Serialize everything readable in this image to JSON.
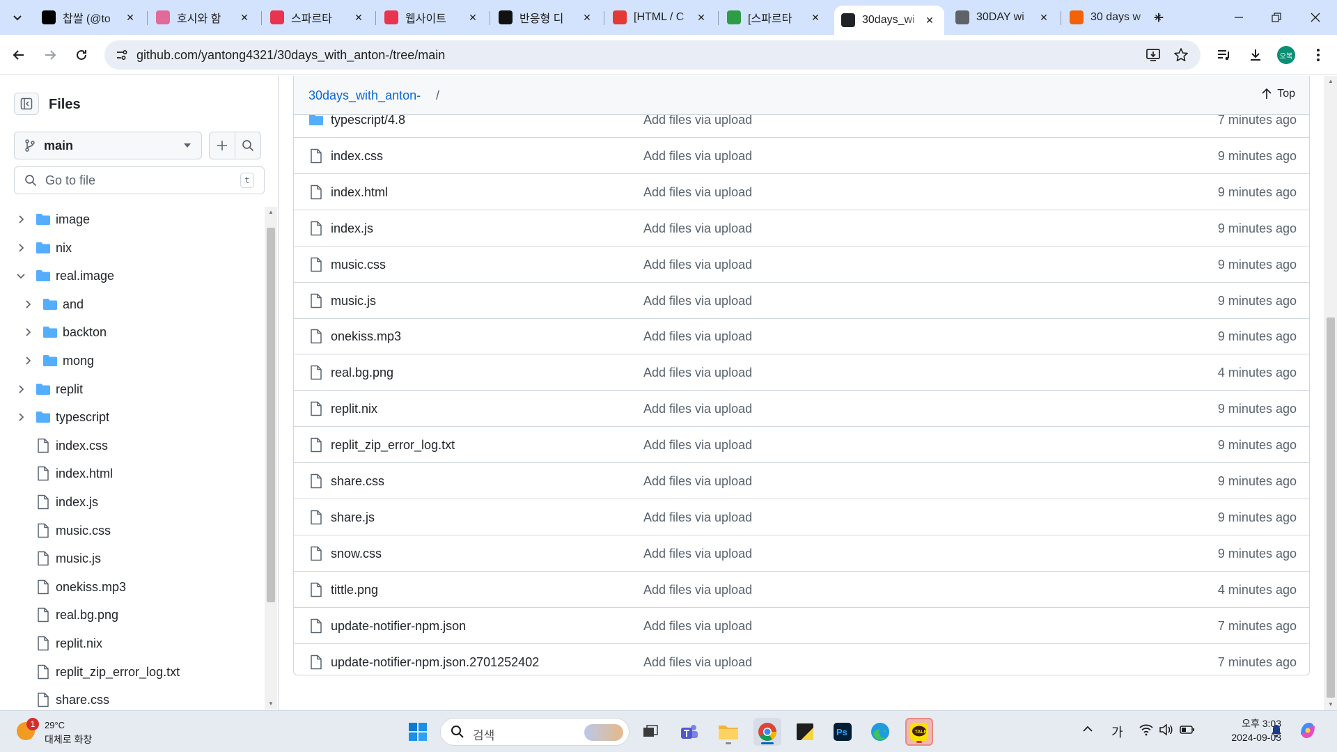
{
  "browser": {
    "tabs": [
      {
        "title": "찹쌀 (@to",
        "icon": "x-logo-icon",
        "color": "#000000"
      },
      {
        "title": "호시와 함",
        "icon": "anime-avatar-icon",
        "color": "#e06a9a"
      },
      {
        "title": "스파르타",
        "icon": "sparta-heart-icon",
        "color": "#e8344e"
      },
      {
        "title": "웹사이트",
        "icon": "sparta-heart-icon",
        "color": "#e8344e"
      },
      {
        "title": "반응형 디",
        "icon": "m-logo-icon",
        "color": "#111111"
      },
      {
        "title": "[HTML / C",
        "icon": "red-circle-icon",
        "color": "#e53935"
      },
      {
        "title": "[스파르타",
        "icon": "green-badge-icon",
        "color": "#2e9b47"
      },
      {
        "title": "30days_wi",
        "icon": "github-icon",
        "color": "#1f2328"
      },
      {
        "title": "30DAY wi",
        "icon": "globe-icon",
        "color": "#5f6368"
      },
      {
        "title": "30 days w",
        "icon": "orange-logo-icon",
        "color": "#f26207"
      }
    ],
    "active_tab_index": 7,
    "url": "github.com/yantong4321/30days_with_anton-/tree/main"
  },
  "sidebar": {
    "title": "Files",
    "branch": "main",
    "goto_placeholder": "Go to file",
    "goto_shortcut": "t",
    "tree": [
      {
        "label": "image",
        "type": "folder",
        "depth": 0,
        "expanded": false
      },
      {
        "label": "nix",
        "type": "folder",
        "depth": 0,
        "expanded": false
      },
      {
        "label": "real.image",
        "type": "folder",
        "depth": 0,
        "expanded": true
      },
      {
        "label": "and",
        "type": "folder",
        "depth": 1,
        "expanded": false
      },
      {
        "label": "backton",
        "type": "folder",
        "depth": 1,
        "expanded": false
      },
      {
        "label": "mong",
        "type": "folder",
        "depth": 1,
        "expanded": false
      },
      {
        "label": "replit",
        "type": "folder",
        "depth": 0,
        "expanded": false
      },
      {
        "label": "typescript",
        "type": "folder",
        "depth": 0,
        "expanded": false
      },
      {
        "label": "index.css",
        "type": "file",
        "depth": 0
      },
      {
        "label": "index.html",
        "type": "file",
        "depth": 0
      },
      {
        "label": "index.js",
        "type": "file",
        "depth": 0
      },
      {
        "label": "music.css",
        "type": "file",
        "depth": 0
      },
      {
        "label": "music.js",
        "type": "file",
        "depth": 0
      },
      {
        "label": "onekiss.mp3",
        "type": "file",
        "depth": 0
      },
      {
        "label": "real.bg.png",
        "type": "file",
        "depth": 0
      },
      {
        "label": "replit.nix",
        "type": "file",
        "depth": 0
      },
      {
        "label": "replit_zip_error_log.txt",
        "type": "file",
        "depth": 0
      },
      {
        "label": "share.css",
        "type": "file",
        "depth": 0
      }
    ]
  },
  "main": {
    "breadcrumb_repo": "30days_with_anton-",
    "breadcrumb_sep": "/",
    "top_label": "Top",
    "files": [
      {
        "name": "typescript/4.8",
        "type": "folder",
        "message": "Add files via upload",
        "age": "7 minutes ago"
      },
      {
        "name": "index.css",
        "type": "file",
        "message": "Add files via upload",
        "age": "9 minutes ago"
      },
      {
        "name": "index.html",
        "type": "file",
        "message": "Add files via upload",
        "age": "9 minutes ago"
      },
      {
        "name": "index.js",
        "type": "file",
        "message": "Add files via upload",
        "age": "9 minutes ago"
      },
      {
        "name": "music.css",
        "type": "file",
        "message": "Add files via upload",
        "age": "9 minutes ago"
      },
      {
        "name": "music.js",
        "type": "file",
        "message": "Add files via upload",
        "age": "9 minutes ago"
      },
      {
        "name": "onekiss.mp3",
        "type": "file",
        "message": "Add files via upload",
        "age": "9 minutes ago"
      },
      {
        "name": "real.bg.png",
        "type": "file",
        "message": "Add files via upload",
        "age": "4 minutes ago"
      },
      {
        "name": "replit.nix",
        "type": "file",
        "message": "Add files via upload",
        "age": "9 minutes ago"
      },
      {
        "name": "replit_zip_error_log.txt",
        "type": "file",
        "message": "Add files via upload",
        "age": "9 minutes ago"
      },
      {
        "name": "share.css",
        "type": "file",
        "message": "Add files via upload",
        "age": "9 minutes ago"
      },
      {
        "name": "share.js",
        "type": "file",
        "message": "Add files via upload",
        "age": "9 minutes ago"
      },
      {
        "name": "snow.css",
        "type": "file",
        "message": "Add files via upload",
        "age": "9 minutes ago"
      },
      {
        "name": "tittle.png",
        "type": "file",
        "message": "Add files via upload",
        "age": "4 minutes ago"
      },
      {
        "name": "update-notifier-npm.json",
        "type": "file",
        "message": "Add files via upload",
        "age": "7 minutes ago"
      },
      {
        "name": "update-notifier-npm.json.2701252402",
        "type": "file",
        "message": "Add files via upload",
        "age": "7 minutes ago"
      }
    ]
  },
  "taskbar": {
    "weather_temp": "29°C",
    "weather_desc": "대체로 화창",
    "weather_badge": "1",
    "search_placeholder": "검색",
    "ime": "가",
    "time": "오후 3:03",
    "date": "2024-09-03",
    "profile_initials": "오복"
  },
  "colors": {
    "accent_link": "#0969da",
    "folder": "#54aeff",
    "tabbar_bg": "#d3e3fd",
    "profile": "#0a8f74"
  }
}
